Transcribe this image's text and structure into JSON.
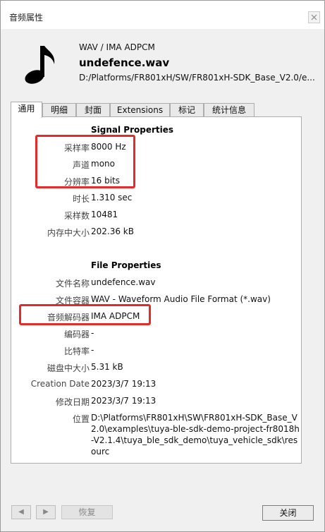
{
  "window": {
    "title": "音频属性"
  },
  "header": {
    "format": "WAV / IMA ADPCM",
    "filename": "undefence.wav",
    "path": "D:/Platforms/FR801xH/SW/FR801xH-SDK_Base_V2.0/e..."
  },
  "tabs": [
    "通用",
    "明细",
    "封面",
    "Extensions",
    "标记",
    "统计信息"
  ],
  "signal": {
    "heading": "Signal Properties",
    "rows": [
      {
        "label": "采样率",
        "value": "8000 Hz"
      },
      {
        "label": "声道",
        "value": "mono"
      },
      {
        "label": "分辨率",
        "value": "16 bits"
      },
      {
        "label": "时长",
        "value": "1.310 sec"
      },
      {
        "label": "采样数",
        "value": "10481"
      },
      {
        "label": "内存中大小",
        "value": "202.36 kB"
      }
    ]
  },
  "file": {
    "heading": "File Properties",
    "rows": [
      {
        "label": "文件名称",
        "value": "undefence.wav"
      },
      {
        "label": "文件容器",
        "value": "WAV - Waveform Audio File Format (*.wav)"
      },
      {
        "label": "音频解码器",
        "value": "IMA ADPCM"
      },
      {
        "label": "编码器",
        "value": "-"
      },
      {
        "label": "比特率",
        "value": "-"
      },
      {
        "label": "磁盘中大小",
        "value": "5.31 kB"
      },
      {
        "label": "Creation Date",
        "value": "2023/3/7 19:13"
      },
      {
        "label": "修改日期",
        "value": "2023/3/7 19:13"
      }
    ],
    "location_label": "位置",
    "location_value": "D:\\Platforms\\FR801xH\\SW\\FR801xH-SDK_Base_V2.0\\examples\\tuya-ble-sdk-demo-project-fr8018h-V2.1.4\\tuya_ble_sdk_demo\\tuya_vehicle_sdk\\resourc"
  },
  "footer": {
    "prev": "◀",
    "next": "▶",
    "restore": "恢复",
    "close": "关闭"
  },
  "colors": {
    "highlight": "#e52a2a"
  },
  "icons": [
    "music-note-icon",
    "close-icon",
    "arrow-left-icon",
    "arrow-right-icon"
  ]
}
